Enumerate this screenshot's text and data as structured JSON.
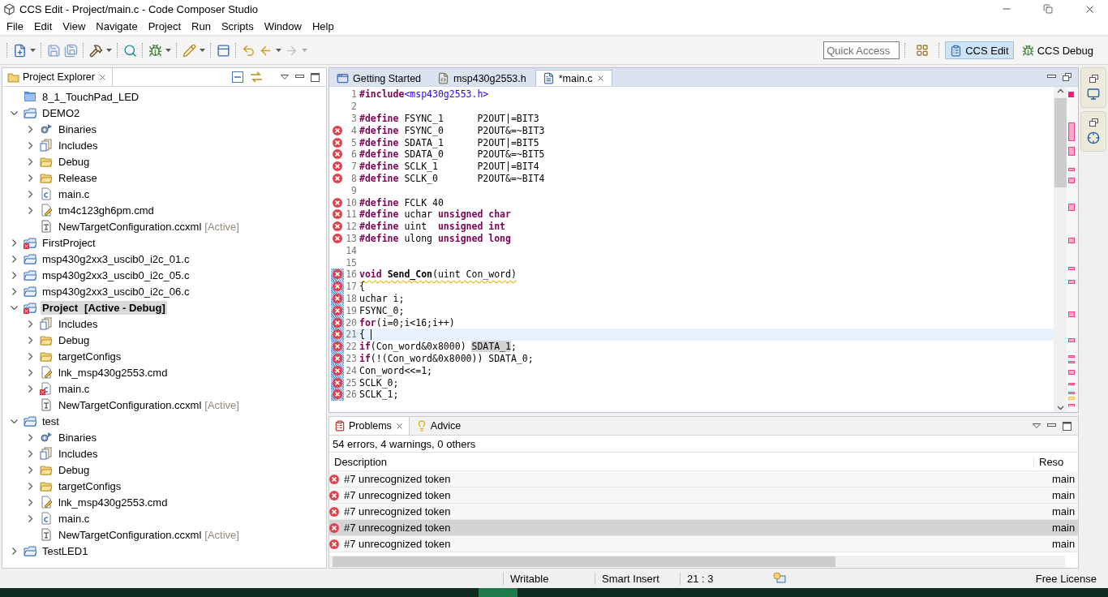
{
  "window": {
    "title": "CCS Edit - Project/main.c - Code Composer Studio"
  },
  "menu": [
    "File",
    "Edit",
    "View",
    "Navigate",
    "Project",
    "Run",
    "Scripts",
    "Window",
    "Help"
  ],
  "quick_access": {
    "placeholder": "Quick Access"
  },
  "perspectives": [
    {
      "label": "CCS Edit",
      "selected": true
    },
    {
      "label": "CCS Debug",
      "selected": false
    }
  ],
  "explorer": {
    "title": "Project Explorer",
    "tree": [
      {
        "label": "8_1_TouchPad_LED",
        "kind": "closed_project",
        "error": false,
        "selected": false
      },
      {
        "label": "DEMO2",
        "kind": "project",
        "expanded": true,
        "error": false,
        "selected": false,
        "children": [
          {
            "label": "Binaries",
            "kind": "binaries",
            "expanded": false,
            "error": false,
            "selected": false
          },
          {
            "label": "Includes",
            "kind": "includes",
            "expanded": false,
            "error": false,
            "selected": false
          },
          {
            "label": "Debug",
            "kind": "folder",
            "expanded": false,
            "error": false,
            "selected": false
          },
          {
            "label": "Release",
            "kind": "folder",
            "expanded": false,
            "error": false,
            "selected": false
          },
          {
            "label": "main.c",
            "kind": "c_file",
            "expanded": false,
            "error": false,
            "selected": false
          },
          {
            "label": "tm4c123gh6pm.cmd",
            "kind": "cmd_file",
            "expanded": false,
            "error": false,
            "selected": false
          },
          {
            "label": "NewTargetConfiguration.ccxml",
            "kind": "ccxml_file",
            "decoration": "[Active]",
            "error": false,
            "selected": false
          }
        ]
      },
      {
        "label": "FirstProject",
        "kind": "project",
        "expanded": false,
        "error": true,
        "selected": false
      },
      {
        "label": "msp430g2xx3_uscib0_i2c_01.c",
        "kind": "project",
        "expanded": false,
        "error": false,
        "selected": false
      },
      {
        "label": "msp430g2xx3_uscib0_i2c_05.c",
        "kind": "project",
        "expanded": false,
        "error": false,
        "selected": false
      },
      {
        "label": "msp430g2xx3_uscib0_i2c_06.c",
        "kind": "project",
        "expanded": false,
        "error": false,
        "selected": false
      },
      {
        "label": "Project",
        "kind": "project",
        "expanded": true,
        "error": true,
        "selected": true,
        "decoration": "[Active - Debug]",
        "children": [
          {
            "label": "Includes",
            "kind": "includes",
            "expanded": false,
            "error": false,
            "selected": false
          },
          {
            "label": "Debug",
            "kind": "folder",
            "expanded": false,
            "error": false,
            "selected": false
          },
          {
            "label": "targetConfigs",
            "kind": "folder",
            "expanded": false,
            "error": false,
            "selected": false
          },
          {
            "label": "lnk_msp430g2553.cmd",
            "kind": "cmd_file",
            "expanded": false,
            "error": false,
            "selected": false
          },
          {
            "label": "main.c",
            "kind": "c_file",
            "expanded": false,
            "error": true,
            "selected": false
          },
          {
            "label": "NewTargetConfiguration.ccxml",
            "kind": "ccxml_file",
            "decoration": "[Active]",
            "error": false,
            "selected": false
          }
        ]
      },
      {
        "label": "test",
        "kind": "project",
        "expanded": true,
        "error": false,
        "selected": false,
        "children": [
          {
            "label": "Binaries",
            "kind": "binaries",
            "expanded": false,
            "error": false,
            "selected": false
          },
          {
            "label": "Includes",
            "kind": "includes",
            "expanded": false,
            "error": false,
            "selected": false
          },
          {
            "label": "Debug",
            "kind": "folder",
            "expanded": false,
            "error": false,
            "selected": false
          },
          {
            "label": "targetConfigs",
            "kind": "folder",
            "expanded": false,
            "error": false,
            "selected": false
          },
          {
            "label": "lnk_msp430g2553.cmd",
            "kind": "cmd_file",
            "expanded": false,
            "error": false,
            "selected": false
          },
          {
            "label": "main.c",
            "kind": "c_file",
            "expanded": false,
            "error": false,
            "selected": false
          },
          {
            "label": "NewTargetConfiguration.ccxml",
            "kind": "ccxml_file",
            "decoration": "[Active]",
            "error": false,
            "selected": false
          }
        ]
      },
      {
        "label": "TestLED1",
        "kind": "project",
        "expanded": false,
        "error": false,
        "selected": false
      }
    ]
  },
  "editor": {
    "tabs": [
      {
        "label": "Getting Started",
        "kind": "page",
        "selected": false
      },
      {
        "label": "msp430g2553.h",
        "kind": "header",
        "selected": false
      },
      {
        "label": "*main.c",
        "kind": "source",
        "selected": true
      }
    ],
    "lines": [
      {
        "number": "1",
        "error": false,
        "changed": false,
        "current": false,
        "segments": [
          {
            "kind": "directive",
            "text": "#include"
          },
          {
            "kind": "include",
            "text": "<msp430g2553.h>"
          }
        ]
      },
      {
        "number": "2",
        "error": false,
        "changed": false,
        "current": false
      },
      {
        "number": "3",
        "error": false,
        "changed": false,
        "current": false,
        "segments": [
          {
            "kind": "directive",
            "text": "#define"
          },
          {
            "kind": "plain",
            "text": " FSYNC_1      P2OUT|=BIT3"
          }
        ]
      },
      {
        "number": "4",
        "error": true,
        "changed": false,
        "current": false,
        "segments": [
          {
            "kind": "directive",
            "text": "#define"
          },
          {
            "kind": "plain",
            "text": " FSYNC_0      P2OUT&=~BIT3"
          }
        ]
      },
      {
        "number": "5",
        "error": true,
        "changed": false,
        "current": false,
        "segments": [
          {
            "kind": "directive",
            "text": "#define"
          },
          {
            "kind": "plain",
            "text": " SDATA_1      P2OUT|=BIT5"
          }
        ]
      },
      {
        "number": "6",
        "error": true,
        "changed": false,
        "current": false,
        "segments": [
          {
            "kind": "directive",
            "text": "#define"
          },
          {
            "kind": "plain",
            "text": " SDATA_0      P2OUT&=~BIT5"
          }
        ]
      },
      {
        "number": "7",
        "error": true,
        "changed": false,
        "current": false,
        "segments": [
          {
            "kind": "directive",
            "text": "#define"
          },
          {
            "kind": "plain",
            "text": " SCLK_1       P2OUT|=BIT4"
          }
        ]
      },
      {
        "number": "8",
        "error": true,
        "changed": false,
        "current": false,
        "segments": [
          {
            "kind": "directive",
            "text": "#define"
          },
          {
            "kind": "plain",
            "text": " SCLK_0       P2OUT&=~BIT4"
          }
        ]
      },
      {
        "number": "9",
        "error": false,
        "changed": false,
        "current": false
      },
      {
        "number": "10",
        "error": true,
        "changed": false,
        "current": false,
        "segments": [
          {
            "kind": "directive",
            "text": "#define"
          },
          {
            "kind": "plain",
            "text": " FCLK 40"
          }
        ]
      },
      {
        "number": "11",
        "error": true,
        "changed": false,
        "current": false,
        "segments": [
          {
            "kind": "directive",
            "text": "#define"
          },
          {
            "kind": "plain",
            "text": " uchar "
          },
          {
            "kind": "type",
            "text": "unsigned char"
          }
        ]
      },
      {
        "number": "12",
        "error": true,
        "changed": false,
        "current": false,
        "segments": [
          {
            "kind": "directive",
            "text": "#define"
          },
          {
            "kind": "plain",
            "text": " uint  "
          },
          {
            "kind": "type",
            "text": "unsigned int"
          }
        ]
      },
      {
        "number": "13",
        "error": true,
        "changed": false,
        "current": false,
        "segments": [
          {
            "kind": "directive",
            "text": "#define"
          },
          {
            "kind": "plain",
            "text": " ulong "
          },
          {
            "kind": "type",
            "text": "unsigned long"
          }
        ]
      },
      {
        "number": "14",
        "error": false,
        "changed": false,
        "current": false
      },
      {
        "number": "15",
        "error": false,
        "changed": false,
        "current": false
      },
      {
        "number": "16",
        "error": true,
        "changed": true,
        "current": false,
        "warning": true,
        "segments": [
          {
            "kind": "type",
            "text": "void"
          },
          {
            "kind": "function",
            "text": " Send_Con"
          },
          {
            "kind": "plain",
            "text": "(uint Con_word)"
          }
        ]
      },
      {
        "number": "17",
        "error": true,
        "changed": true,
        "current": false,
        "segments": [
          {
            "kind": "plain",
            "text": "{"
          }
        ]
      },
      {
        "number": "18",
        "error": true,
        "changed": true,
        "current": false,
        "segments": [
          {
            "kind": "plain",
            "text": "uchar i;"
          }
        ]
      },
      {
        "number": "19",
        "error": true,
        "changed": true,
        "current": false,
        "segments": [
          {
            "kind": "plain",
            "text": "FSYNC_0;"
          }
        ]
      },
      {
        "number": "20",
        "error": true,
        "changed": true,
        "current": false,
        "segments": [
          {
            "kind": "type",
            "text": "for"
          },
          {
            "kind": "plain",
            "text": "(i=0;i<16;i++)"
          }
        ]
      },
      {
        "number": "21",
        "error": true,
        "changed": true,
        "current": true,
        "segments": [
          {
            "kind": "plain",
            "text": "{ "
          }
        ]
      },
      {
        "number": "22",
        "error": true,
        "changed": true,
        "current": false,
        "segments": [
          {
            "kind": "type",
            "text": "if"
          },
          {
            "kind": "plain",
            "text": "(Con_word&0x8000) "
          },
          {
            "kind": "occurrence",
            "text": "SDATA_1"
          },
          {
            "kind": "plain",
            "text": ";"
          }
        ]
      },
      {
        "number": "23",
        "error": true,
        "changed": true,
        "current": false,
        "segments": [
          {
            "kind": "type",
            "text": "if"
          },
          {
            "kind": "plain",
            "text": "(!(Con_word&0x8000)) SDATA_0;"
          }
        ]
      },
      {
        "number": "24",
        "error": true,
        "changed": true,
        "current": false,
        "segments": [
          {
            "kind": "plain",
            "text": "Con_word<<=1;"
          }
        ]
      },
      {
        "number": "25",
        "error": true,
        "changed": true,
        "current": false,
        "segments": [
          {
            "kind": "plain",
            "text": "SCLK_0;"
          }
        ]
      },
      {
        "number": "26",
        "error": true,
        "changed": true,
        "current": false,
        "segments": [
          {
            "kind": "plain",
            "text": "SCLK_1;"
          }
        ]
      }
    ]
  },
  "problems": {
    "tabs": [
      {
        "label": "Problems",
        "kind": "problems",
        "selected": true
      },
      {
        "label": "Advice",
        "kind": "advice",
        "selected": false
      }
    ],
    "summary": "54 errors, 4 warnings, 0 others",
    "columns": [
      "Description",
      "Reso"
    ],
    "rows": [
      {
        "description": "#7 unrecognized token",
        "resource": "main",
        "selected": false
      },
      {
        "description": "#7 unrecognized token",
        "resource": "main",
        "selected": false
      },
      {
        "description": "#7 unrecognized token",
        "resource": "main",
        "selected": false
      },
      {
        "description": "#7 unrecognized token",
        "resource": "main",
        "selected": true
      },
      {
        "description": "#7 unrecognized token",
        "resource": "main",
        "selected": false
      }
    ]
  },
  "status_bar": {
    "items": [
      "Writable",
      "Smart Insert",
      "21 : 3"
    ],
    "license": "Free License"
  }
}
